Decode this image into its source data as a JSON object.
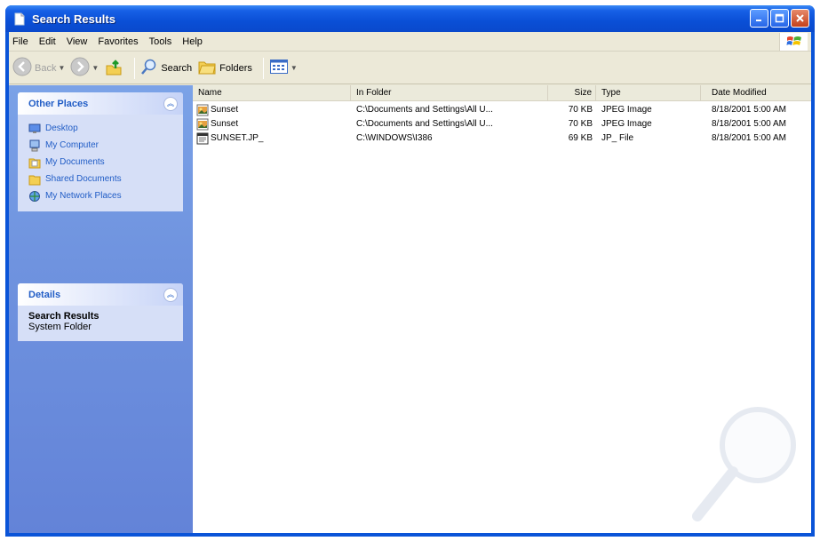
{
  "window": {
    "title": "Search Results"
  },
  "menu": [
    "File",
    "Edit",
    "View",
    "Favorites",
    "Tools",
    "Help"
  ],
  "toolbar": {
    "back_label": "Back",
    "search_label": "Search",
    "folders_label": "Folders"
  },
  "sidebar": {
    "other_places": {
      "title": "Other Places",
      "items": [
        {
          "label": "Desktop",
          "icon": "desktop-icon"
        },
        {
          "label": "My Computer",
          "icon": "my-computer-icon"
        },
        {
          "label": "My Documents",
          "icon": "my-documents-icon"
        },
        {
          "label": "Shared Documents",
          "icon": "shared-documents-icon"
        },
        {
          "label": "My Network Places",
          "icon": "network-places-icon"
        }
      ]
    },
    "details": {
      "title": "Details",
      "name": "Search Results",
      "type": "System Folder"
    }
  },
  "list": {
    "columns": [
      "Name",
      "In Folder",
      "Size",
      "Type",
      "Date Modified"
    ],
    "rows": [
      {
        "name": "Sunset",
        "folder": "C:\\Documents and Settings\\All U...",
        "size": "70 KB",
        "type": "JPEG Image",
        "date": "8/18/2001 5:00 AM",
        "icon": "jpeg-file-icon"
      },
      {
        "name": "Sunset",
        "folder": "C:\\Documents and Settings\\All U...",
        "size": "70 KB",
        "type": "JPEG Image",
        "date": "8/18/2001 5:00 AM",
        "icon": "jpeg-file-icon"
      },
      {
        "name": "SUNSET.JP_",
        "folder": "C:\\WINDOWS\\I386",
        "size": "69 KB",
        "type": "JP_ File",
        "date": "8/18/2001 5:00 AM",
        "icon": "generic-file-icon"
      }
    ]
  },
  "colors": {
    "title_bar": "#0a54d8",
    "task_pane": "#6f93df",
    "link": "#215dc6",
    "chrome": "#ece9d8"
  }
}
